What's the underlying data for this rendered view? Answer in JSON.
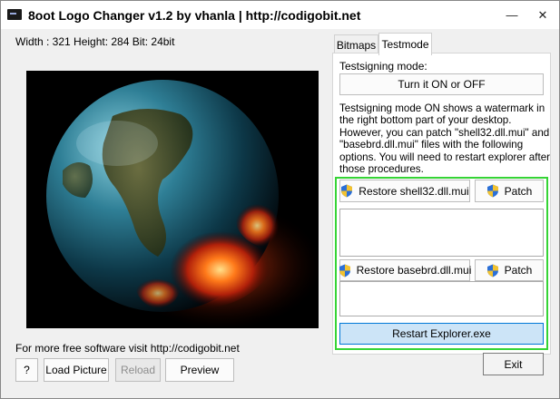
{
  "window": {
    "title": "8oot Logo Changer v1.2 by vhanla | http://codigobit.net",
    "minimize_glyph": "—",
    "close_glyph": "✕"
  },
  "image_info": "Width : 321 Height: 284 Bit: 24bit",
  "footer": {
    "text": "For more free software visit  http://codigobit.net",
    "help_button": "?",
    "load_button": "Load Picture",
    "reload_button": "Reload",
    "preview_button": "Preview"
  },
  "tabs": [
    {
      "label": "Bitmaps",
      "active": false
    },
    {
      "label": "Testmode",
      "active": true
    }
  ],
  "testmode": {
    "label": "Testsigning mode:",
    "toggle_button": "Turn it ON or OFF",
    "description": "Testsigning mode ON shows a watermark in the right bottom part of your desktop. However,  you can patch \"shell32.dll.mui\" and \"basebrd.dll.mui\" files with the following options. You will need to restart explorer after those procedures.",
    "restore_shell32": "Restore shell32.dll.mui",
    "patch1": "Patch",
    "restore_basebrd": "Restore basebrd.dll.mui",
    "patch2": "Patch",
    "restart_button": "Restart Explorer.exe"
  },
  "exit_button": "Exit",
  "colors": {
    "highlight_border": "#35d435",
    "restart_button_bg": "#cce4f7",
    "restart_button_border": "#0078d7"
  },
  "icons": {
    "shield": "uac-shield-icon",
    "app": "app-icon"
  }
}
